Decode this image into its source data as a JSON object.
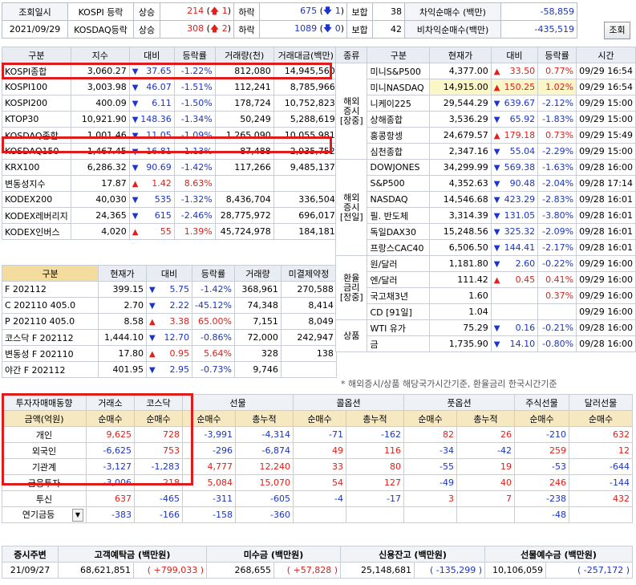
{
  "top": {
    "lab_time": "조회일시",
    "date": "2021/09/29",
    "rows": [
      {
        "name": "KOSPI 등락",
        "rise_lbl": "상승",
        "rise": "214",
        "up": "1",
        "fall_lbl": "하락",
        "fall": "675",
        "down": "1",
        "flat_lbl": "보합",
        "flat": "38",
        "net_lbl": "차익순매수 (백만)",
        "net": "-58,859"
      },
      {
        "name": "KOSDAQ등락",
        "rise_lbl": "상승",
        "rise": "308",
        "up": "2",
        "fall_lbl": "하락",
        "fall": "1089",
        "down": "0",
        "flat_lbl": "보합",
        "flat": "42",
        "net_lbl": "비차익순매수(백만)",
        "net": "-435,519"
      }
    ],
    "refresh": "조회"
  },
  "indices": {
    "headers": [
      "구분",
      "지수",
      "대비",
      "등락률",
      "거래량(천)",
      "거래대금(백만)"
    ],
    "rows": [
      {
        "name": "KOSPI종합",
        "val": "3,060.27",
        "dir": "dn",
        "chg": "37.65",
        "pct": "-1.22%",
        "vol": "812,080",
        "amt": "14,945,560"
      },
      {
        "name": "KOSPI100",
        "val": "3,003.98",
        "dir": "dn",
        "chg": "46.07",
        "pct": "-1.51%",
        "vol": "112,241",
        "amt": "8,785,966"
      },
      {
        "name": "KOSPI200",
        "val": "400.09",
        "dir": "dn",
        "chg": "6.11",
        "pct": "-1.50%",
        "vol": "178,724",
        "amt": "10,752,823"
      },
      {
        "name": "KTOP30",
        "val": "10,921.90",
        "dir": "dn",
        "chg": "148.36",
        "pct": "-1.34%",
        "vol": "50,249",
        "amt": "5,288,619"
      },
      {
        "name": "KOSDAQ종합",
        "val": "1,001.46",
        "dir": "dn",
        "chg": "11.05",
        "pct": "-1.09%",
        "vol": "1,265,090",
        "amt": "10,055,981"
      },
      {
        "name": "KOSDAQ150",
        "val": "1,467.45",
        "dir": "dn",
        "chg": "16.81",
        "pct": "-1.13%",
        "vol": "87,488",
        "amt": "2,935,752"
      },
      {
        "name": "KRX100",
        "val": "6,286.32",
        "dir": "dn",
        "chg": "90.69",
        "pct": "-1.42%",
        "vol": "117,266",
        "amt": "9,485,137"
      },
      {
        "name": "변동성지수",
        "val": "17.87",
        "dir": "up",
        "chg": "1.42",
        "pct": "8.63%",
        "vol": "",
        "amt": ""
      },
      {
        "name": "KODEX200",
        "val": "40,030",
        "dir": "dn",
        "chg": "535",
        "pct": "-1.32%",
        "vol": "8,436,704",
        "amt": "336,504"
      },
      {
        "name": "KODEX레버리지",
        "val": "24,365",
        "dir": "dn",
        "chg": "615",
        "pct": "-2.46%",
        "vol": "28,775,972",
        "amt": "696,017"
      },
      {
        "name": "KODEX인버스",
        "val": "4,020",
        "dir": "up",
        "chg": "55",
        "pct": "1.39%",
        "vol": "45,724,978",
        "amt": "184,181"
      }
    ]
  },
  "futures": {
    "headers": [
      "구분",
      "현재가",
      "대비",
      "등락률",
      "거래량",
      "미결제약정"
    ],
    "rows": [
      {
        "name": "F 202112",
        "val": "399.15",
        "dir": "dn",
        "chg": "5.75",
        "pct": "-1.42%",
        "vol": "368,961",
        "oi": "270,588"
      },
      {
        "name": "C 202110 405.0",
        "val": "2.70",
        "dir": "dn",
        "chg": "2.22",
        "pct": "-45.12%",
        "vol": "74,348",
        "oi": "8,414"
      },
      {
        "name": "P 202110 405.0",
        "val": "8.58",
        "dir": "up",
        "chg": "3.38",
        "pct": "65.00%",
        "vol": "7,151",
        "oi": "8,049"
      },
      {
        "name": "코스닥 F 202112",
        "val": "1,444.10",
        "dir": "dn",
        "chg": "12.70",
        "pct": "-0.86%",
        "vol": "72,000",
        "oi": "242,947"
      },
      {
        "name": "변동성 F 202110",
        "val": "17.80",
        "dir": "up",
        "chg": "0.95",
        "pct": "5.64%",
        "vol": "328",
        "oi": "138"
      },
      {
        "name": "야간 F 202112",
        "val": "401.95",
        "dir": "dn",
        "chg": "2.95",
        "pct": "-0.73%",
        "vol": "9,746",
        "oi": ""
      }
    ]
  },
  "overseas": {
    "headers": [
      "종류",
      "구분",
      "현재가",
      "대비",
      "등락률",
      "시간"
    ],
    "groups": [
      {
        "label": "해외 증시 [장중]",
        "rows": [
          {
            "name": "미니S&P500",
            "val": "4,377.00",
            "dir": "up",
            "chg": "33.50",
            "pct": "0.77%",
            "time": "09/29 16:54"
          },
          {
            "name": "미니NASDAQ",
            "val": "14,915.00",
            "dir": "up",
            "chg": "150.25",
            "pct": "1.02%",
            "time": "09/29 16:54",
            "hl": true
          },
          {
            "name": "니케이225",
            "val": "29,544.29",
            "dir": "dn",
            "chg": "639.67",
            "pct": "-2.12%",
            "time": "09/29 15:00"
          },
          {
            "name": "상해종합",
            "val": "3,536.29",
            "dir": "dn",
            "chg": "65.92",
            "pct": "-1.83%",
            "time": "09/29 15:00"
          },
          {
            "name": "홍콩항셍",
            "val": "24,679.57",
            "dir": "up",
            "chg": "179.18",
            "pct": "0.73%",
            "time": "09/29 15:49"
          },
          {
            "name": "심천종합",
            "val": "2,347.16",
            "dir": "dn",
            "chg": "55.04",
            "pct": "-2.29%",
            "time": "09/29 15:00"
          }
        ]
      },
      {
        "label": "해외 증시 [전일]",
        "rows": [
          {
            "name": "DOWJONES",
            "val": "34,299.99",
            "dir": "dn",
            "chg": "569.38",
            "pct": "-1.63%",
            "time": "09/28 16:00"
          },
          {
            "name": "S&P500",
            "val": "4,352.63",
            "dir": "dn",
            "chg": "90.48",
            "pct": "-2.04%",
            "time": "09/28 17:14"
          },
          {
            "name": "NASDAQ",
            "val": "14,546.68",
            "dir": "dn",
            "chg": "423.29",
            "pct": "-2.83%",
            "time": "09/28 16:01"
          },
          {
            "name": "필. 반도체",
            "val": "3,314.39",
            "dir": "dn",
            "chg": "131.05",
            "pct": "-3.80%",
            "time": "09/28 16:01"
          },
          {
            "name": "독일DAX30",
            "val": "15,248.56",
            "dir": "dn",
            "chg": "325.32",
            "pct": "-2.09%",
            "time": "09/28 16:01"
          },
          {
            "name": "프랑스CAC40",
            "val": "6,506.50",
            "dir": "dn",
            "chg": "144.41",
            "pct": "-2.17%",
            "time": "09/28 16:01"
          }
        ]
      },
      {
        "label": "환율 금리 [장중]",
        "rows": [
          {
            "name": "원/달러",
            "val": "1,181.80",
            "dir": "dn",
            "chg": "2.60",
            "pct": "-0.22%",
            "time": "09/29 16:00"
          },
          {
            "name": "엔/달러",
            "val": "111.42",
            "dir": "up",
            "chg": "0.45",
            "pct": "0.41%",
            "time": "09/29 16:00"
          },
          {
            "name": "국고채3년",
            "val": "1.60",
            "dir": "",
            "chg": "",
            "pct": "0.37%",
            "time": "09/29 16:00"
          },
          {
            "name": "CD [91일]",
            "val": "1.04",
            "dir": "",
            "chg": "",
            "pct": "",
            "time": "09/29 16:00"
          }
        ]
      },
      {
        "label": "상품",
        "rows": [
          {
            "name": "WTI 유가",
            "val": "75.29",
            "dir": "dn",
            "chg": "0.16",
            "pct": "-0.21%",
            "time": "09/28 16:00"
          },
          {
            "name": "금",
            "val": "1,735.90",
            "dir": "dn",
            "chg": "14.10",
            "pct": "-0.80%",
            "time": "09/28 16:00"
          }
        ]
      }
    ],
    "note": "* 해외증시/상품 해당국가시간기준, 환율금리 한국시간기준"
  },
  "investors": {
    "title": "투자자매매동향",
    "unit": "금액(억원)",
    "cols": [
      "거래소",
      "코스닥",
      "선물",
      "콜옵션",
      "풋옵션",
      "주식선물",
      "달러선물"
    ],
    "sub": [
      "순매수",
      "순매수",
      "순매수",
      "총누적",
      "순매수",
      "총누적",
      "순매수",
      "총누적",
      "순매수",
      "순매수"
    ],
    "rows": [
      {
        "name": "개인",
        "vals": [
          "9,625",
          "728",
          "-3,991",
          "-4,314",
          "-71",
          "-162",
          "82",
          "26",
          "-210",
          "632"
        ]
      },
      {
        "name": "외국인",
        "vals": [
          "-6,625",
          "753",
          "-296",
          "-6,874",
          "49",
          "116",
          "-34",
          "-42",
          "259",
          "12"
        ]
      },
      {
        "name": "기관계",
        "vals": [
          "-3,127",
          "-1,283",
          "4,777",
          "12,240",
          "33",
          "80",
          "-55",
          "19",
          "-53",
          "-644"
        ]
      },
      {
        "name": "금융투자",
        "vals": [
          "-3,006",
          "218",
          "5,084",
          "15,070",
          "54",
          "127",
          "-49",
          "40",
          "246",
          "-144"
        ]
      },
      {
        "name": "투신",
        "vals": [
          "637",
          "-465",
          "-311",
          "-605",
          "-4",
          "-17",
          "3",
          "7",
          "-238",
          "432"
        ]
      },
      {
        "name": "연기금등",
        "vals": [
          "-383",
          "-166",
          "-158",
          "-360",
          "",
          "",
          "",
          "",
          "-48",
          ""
        ]
      }
    ]
  },
  "bottom": {
    "headers": [
      "증시주변",
      "고객예탁금 (백만원)",
      "미수금 (백만원)",
      "신용잔고 (백만원)",
      "선물예수금 (백만원)"
    ],
    "date": "21/09/27",
    "vals": [
      {
        "v": "68,621,851",
        "d": "+799,033"
      },
      {
        "v": "268,655",
        "d": "+57,828"
      },
      {
        "v": "25,148,681",
        "d": "-135,299"
      },
      {
        "v": "10,106,059",
        "d": "-257,172"
      }
    ]
  },
  "colors": {
    "up": "#e0201b",
    "down": "#1a35c8",
    "highlight_box": "#e01b1b"
  }
}
